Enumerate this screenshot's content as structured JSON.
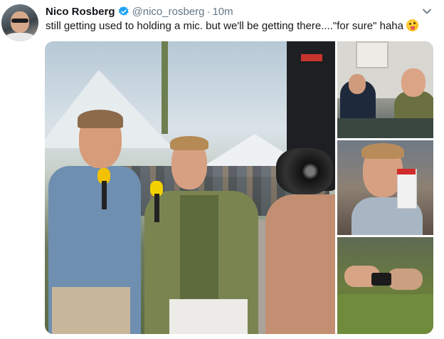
{
  "tweet": {
    "author_name": "Nico Rosberg",
    "handle": "@nico_rosberg",
    "separator": "·",
    "time": "10m",
    "text": "still getting used to holding a mic. but we'll be getting there....\"for sure\" haha",
    "emoji": "winking-face-with-tongue",
    "verified_color": "#1da1f2",
    "icons": {
      "verified": "verified-badge-icon",
      "menu": "chevron-down-icon"
    },
    "media_count": 4
  }
}
